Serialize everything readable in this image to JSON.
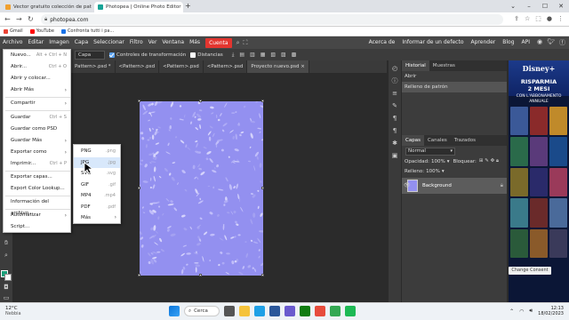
{
  "browser": {
    "tabs": [
      {
        "title": "Vector gratuito colección de pat",
        "favicon_color": "#f0a030",
        "active": false
      },
      {
        "title": "Photopea | Online Photo Editor",
        "favicon_color": "#18a497",
        "active": true
      }
    ],
    "new_tab": "+",
    "url": "photopea.com",
    "bookmarks": [
      {
        "label": "Gmail",
        "color": "#ea4335"
      },
      {
        "label": "YouTube",
        "color": "#ff0000"
      },
      {
        "label": "Confronta tutti i pa...",
        "color": "#1a73e8"
      }
    ]
  },
  "app": {
    "menu": [
      "Archivo",
      "Editar",
      "Imagen",
      "Capa",
      "Seleccionar",
      "Filtro",
      "Ver",
      "Ventana",
      "Más"
    ],
    "cuenta": "Cuenta",
    "menu_right": [
      "Acerca de",
      "Informar de un defecto",
      "Aprender",
      "Blog",
      "API"
    ],
    "options": {
      "layer_select": "Capa",
      "transform_controls": "Controles de transformación",
      "distances": "Distancias"
    },
    "doc_tabs": [
      "Pattern>.psd *",
      "<Pattern>.psd",
      "<Pattern>.psd",
      "<Pattern>.psd",
      "Proyecto nuevo.psd"
    ],
    "doc_tab_close": "×",
    "history_panel": {
      "tabs": [
        "Historial",
        "Muestras"
      ],
      "items": [
        "Abrir",
        "Relleno de patrón"
      ]
    },
    "layers_panel": {
      "tabs": [
        "Capas",
        "Canales",
        "Trazados"
      ],
      "blend_mode": "Normal",
      "opacity_label": "Opacidad:",
      "opacity_value": "100%",
      "lock_label": "Bloquear:",
      "fill_label": "Relleno:",
      "fill_value": "100%",
      "layer_name": "Background"
    },
    "file_menu": [
      {
        "label": "Nuevo...",
        "shortcut": "Alt + Ctrl + N"
      },
      {
        "label": "Abrir...",
        "shortcut": "Ctrl + O"
      },
      {
        "label": "Abrir y colocar...",
        "shortcut": ""
      },
      {
        "label": "Abrir Más",
        "submenu": true
      },
      {
        "label": "Compartir",
        "submenu": true
      },
      {
        "label": "Guardar",
        "shortcut": "Ctrl + S"
      },
      {
        "label": "Guardar como PSD",
        "shortcut": ""
      },
      {
        "label": "Guardar Más",
        "submenu": true
      },
      {
        "label": "Exportar como",
        "submenu": true
      },
      {
        "label": "Imprimir...",
        "shortcut": "Ctrl + P"
      },
      {
        "label": "Exportar capas...",
        "shortcut": ""
      },
      {
        "label": "Export Color Lookup...",
        "shortcut": ""
      },
      {
        "label": "Información del archivo...",
        "shortcut": ""
      },
      {
        "label": "Automatizar",
        "submenu": true
      },
      {
        "label": "Script...",
        "shortcut": ""
      }
    ],
    "export_submenu": [
      {
        "label": "PNG",
        "ext": ".png"
      },
      {
        "label": "JPG",
        "ext": ".jpg",
        "hover": true
      },
      {
        "label": "SVG",
        "ext": ".svg"
      },
      {
        "label": "GIF",
        "ext": ".gif"
      },
      {
        "label": "MP4",
        "ext": ".mp4"
      },
      {
        "label": "PDF",
        "ext": ".pdf"
      },
      {
        "label": "Más",
        "ext": "",
        "submenu": true
      }
    ]
  },
  "ad": {
    "logo": "Disney+",
    "headline_1": "RISPARMIA",
    "headline_2": "2 MESI",
    "small": "CON L'ABBONAMENTO ANNUALE",
    "button": "",
    "change_consent": "Change Consent"
  },
  "taskbar": {
    "weather_temp": "12°C",
    "weather_desc": "Nebbia",
    "search": "Cerca",
    "time": "12:13",
    "date": "18/02/2023"
  },
  "colors": {
    "accent": "#e3352f",
    "pattern_bg": "#9390f0",
    "selection": "#d8e8fb"
  }
}
